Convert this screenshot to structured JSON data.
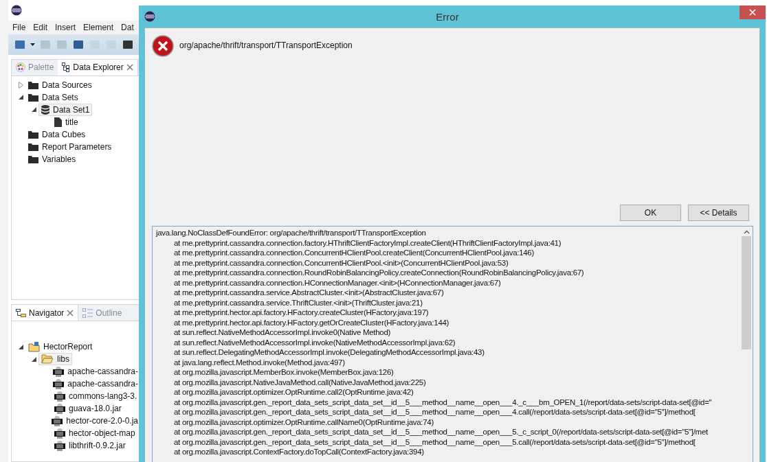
{
  "app": {
    "menu": [
      "File",
      "Edit",
      "Insert",
      "Element",
      "Dat"
    ],
    "top_tabs": [
      {
        "label": "Palette",
        "selected": false,
        "kind": "palette",
        "closable": false
      },
      {
        "label": "Data Explorer",
        "selected": true,
        "kind": "explorer",
        "closable": true
      }
    ],
    "data_tree": [
      {
        "label": "Data Sources",
        "kind": "folder",
        "expanded": false,
        "selected": false
      },
      {
        "label": "Data Sets",
        "kind": "folder",
        "expanded": true,
        "selected": false,
        "children": [
          {
            "label": "Data Set1",
            "kind": "dataset",
            "expanded": true,
            "selected": true,
            "children": [
              {
                "label": "title",
                "kind": "file",
                "selected": false
              }
            ]
          }
        ]
      },
      {
        "label": "Data Cubes",
        "kind": "folder",
        "selected": false
      },
      {
        "label": "Report Parameters",
        "kind": "folder",
        "selected": false
      },
      {
        "label": "Variables",
        "kind": "folder",
        "selected": false
      }
    ],
    "bottom_tabs": [
      {
        "label": "Navigator",
        "selected": true,
        "kind": "navigator",
        "closable": true
      },
      {
        "label": "Outline",
        "selected": false,
        "kind": "outline",
        "closable": false
      }
    ],
    "nav_tree": [
      {
        "label": "HectorReport",
        "kind": "project",
        "expanded": true,
        "selected": false,
        "children": [
          {
            "label": "libs",
            "kind": "openfolder",
            "expanded": true,
            "selected": true,
            "children": [
              {
                "label": "apache-cassandra-",
                "kind": "jar",
                "selected": false
              },
              {
                "label": "apache-cassandra-",
                "kind": "jar",
                "selected": false
              },
              {
                "label": "commons-lang3-3.",
                "kind": "jar",
                "selected": false
              },
              {
                "label": "guava-18.0.jar",
                "kind": "jar",
                "selected": false
              },
              {
                "label": "hector-core-2.0-0.ja",
                "kind": "jar",
                "selected": false
              },
              {
                "label": "hector-object-map",
                "kind": "jar",
                "selected": false
              },
              {
                "label": "libthrift-0.9.2.jar",
                "kind": "jar",
                "selected": false
              }
            ]
          }
        ]
      }
    ]
  },
  "dialog": {
    "title": "Error",
    "message": "org/apache/thrift/transport/TTransportException",
    "buttons": [
      "OK",
      "<< Details"
    ],
    "details": [
      "java.lang.NoClassDefFoundError: org/apache/thrift/transport/TTransportException",
      "at me.prettyprint.cassandra.connection.factory.HThriftClientFactoryImpl.createClient(HThriftClientFactoryImpl.java:41)",
      "at me.prettyprint.cassandra.connection.ConcurrentHClientPool.createClient(ConcurrentHClientPool.java:146)",
      "at me.prettyprint.cassandra.connection.ConcurrentHClientPool.<init>(ConcurrentHClientPool.java:53)",
      "at me.prettyprint.cassandra.connection.RoundRobinBalancingPolicy.createConnection(RoundRobinBalancingPolicy.java:67)",
      "at me.prettyprint.cassandra.connection.HConnectionManager.<init>(HConnectionManager.java:67)",
      "at me.prettyprint.cassandra.service.AbstractCluster.<init>(AbstractCluster.java:67)",
      "at me.prettyprint.cassandra.service.ThriftCluster.<init>(ThriftCluster.java:21)",
      "at me.prettyprint.hector.api.factory.HFactory.createCluster(HFactory.java:197)",
      "at me.prettyprint.hector.api.factory.HFactory.getOrCreateCluster(HFactory.java:144)",
      "at sun.reflect.NativeMethodAccessorImpl.invoke0(Native Method)",
      "at sun.reflect.NativeMethodAccessorImpl.invoke(NativeMethodAccessorImpl.java:62)",
      "at sun.reflect.DelegatingMethodAccessorImpl.invoke(DelegatingMethodAccessorImpl.java:43)",
      "at java.lang.reflect.Method.invoke(Method.java:497)",
      "at org.mozilla.javascript.MemberBox.invoke(MemberBox.java:126)",
      "at org.mozilla.javascript.NativeJavaMethod.call(NativeJavaMethod.java:225)",
      "at org.mozilla.javascript.optimizer.OptRuntime.call2(OptRuntime.java:42)",
      "at org.mozilla.javascript.gen._report_data_sets_script_data_set__id__5___method__name__open___4._c___bm_OPEN_1(/report/data-sets/script-data-set[@id=\"",
      "at org.mozilla.javascript.gen._report_data_sets_script_data_set__id__5___method__name__open___4.call(/report/data-sets/script-data-set[@id=\"5\"]/method[",
      "at org.mozilla.javascript.optimizer.OptRuntime.callName0(OptRuntime.java:74)",
      "at org.mozilla.javascript.gen._report_data_sets_script_data_set__id__5___method__name__open___5._c_script_0(/report/data-sets/script-data-set[@id=\"5\"]/met",
      "at org.mozilla.javascript.gen._report_data_sets_script_data_set__id__5___method__name__open___5.call(/report/data-sets/script-data-set[@id=\"5\"]/method[",
      "at org.mozilla.javascript.ContextFactory.doTopCall(ContextFactory.java:394)"
    ]
  }
}
